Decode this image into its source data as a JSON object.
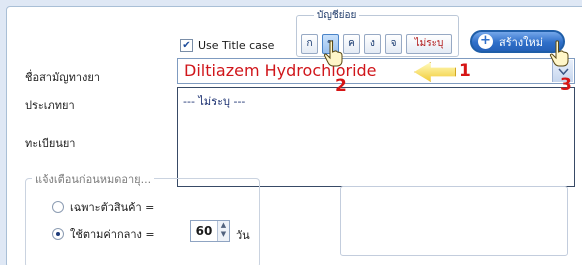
{
  "form": {
    "use_title_case_label": "Use Title case",
    "use_title_case_checked": true,
    "generic_name_label": "ชื่อสามัญทางยา",
    "generic_name_value": "Diltiazem Hydrochloride",
    "type_label": "ประเภทยา",
    "registration_label": "ทะเบียนยา",
    "dropdown_option": "--- ไม่ระบุ ---"
  },
  "sub_account": {
    "title": "บัญชีย่อย",
    "buttons": [
      "ก",
      "ข",
      "ค",
      "ง",
      "จ",
      "ไม่ระบุ"
    ],
    "active_index": 1
  },
  "create_button": {
    "label": "สร้างใหม่"
  },
  "expiry": {
    "group_title": "แจ้งเตือนก่อนหมดอายุ...",
    "option_product_label": "เฉพาะตัวสินค้า =",
    "option_default_label": "ใช้ตามค่ากลาง =",
    "default_value": "60",
    "unit_label": "วัน",
    "selected": "default"
  },
  "annotations": {
    "step1": "1",
    "step2": "2",
    "step3": "3"
  },
  "colors": {
    "accent": "#2f6fc9",
    "highlight": "#d0161b",
    "marker": "#f2cd3c"
  }
}
